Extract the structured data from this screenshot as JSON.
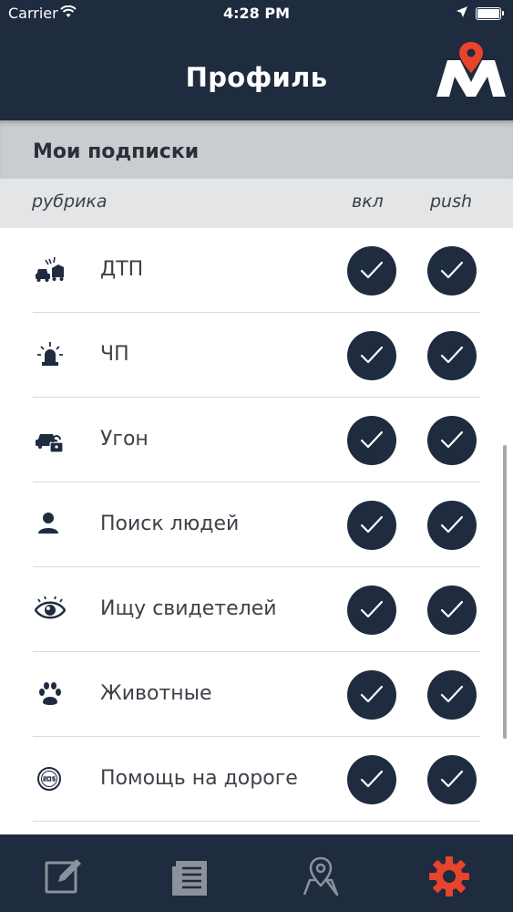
{
  "status_bar": {
    "carrier": "Carrier",
    "time": "4:28 PM"
  },
  "header": {
    "title": "Профиль",
    "logo_letter": "M"
  },
  "section": {
    "title": "Мои подписки"
  },
  "columns": {
    "category": "рубрика",
    "enabled": "вкл",
    "push": "push"
  },
  "rows": [
    {
      "label": "ДТП",
      "icon": "car-crash-icon",
      "enabled": true,
      "push": true
    },
    {
      "label": "ЧП",
      "icon": "siren-icon",
      "enabled": true,
      "push": true
    },
    {
      "label": "Угон",
      "icon": "car-lock-icon",
      "enabled": true,
      "push": true
    },
    {
      "label": "Поиск людей",
      "icon": "person-icon",
      "enabled": true,
      "push": true
    },
    {
      "label": "Ищу свидетелей",
      "icon": "eye-icon",
      "enabled": true,
      "push": true
    },
    {
      "label": "Животные",
      "icon": "paw-icon",
      "enabled": true,
      "push": true
    },
    {
      "label": "Помощь на дороге",
      "icon": "sos-icon",
      "enabled": true,
      "push": true
    }
  ],
  "tabbar": {
    "tabs": [
      {
        "name": "edit-tab",
        "icon": "edit-icon",
        "active": false
      },
      {
        "name": "news-tab",
        "icon": "newspaper-icon",
        "active": false
      },
      {
        "name": "map-tab",
        "icon": "map-pin-icon",
        "active": false
      },
      {
        "name": "settings-tab",
        "icon": "gear-icon",
        "active": true
      }
    ]
  },
  "colors": {
    "navy": "#1f2b3e",
    "accent": "#e8432d",
    "section_bg": "#c9cdd1",
    "header_bg": "#e3e5e7"
  }
}
